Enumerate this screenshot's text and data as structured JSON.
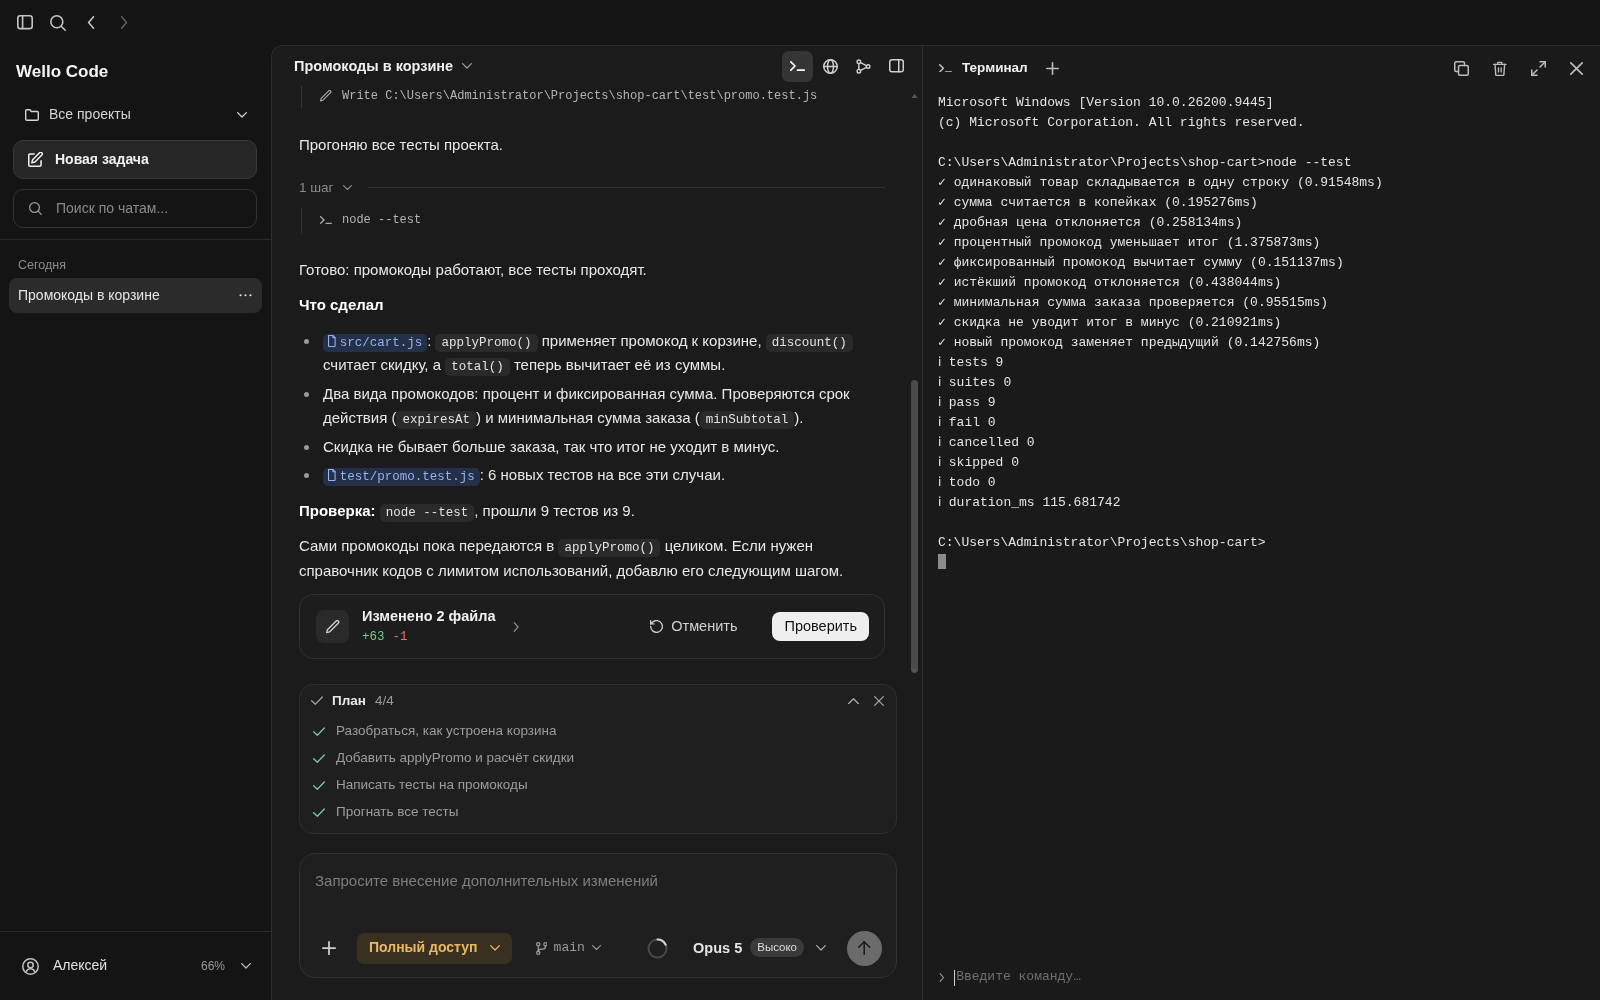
{
  "navigation": {
    "back_disabled": false,
    "forward_disabled": true
  },
  "sidebar": {
    "app_title": "Wello Code",
    "project_filter": "Все проекты",
    "new_task": "Новая задача",
    "search": {
      "placeholder": "Поиск по чатам..."
    },
    "sections": [
      {
        "heading": "Сегодня",
        "items": [
          {
            "label": "Промокоды в корзине",
            "selected": true
          }
        ]
      }
    ],
    "user": {
      "name": "Алексей",
      "usage": "66%"
    }
  },
  "chat": {
    "title": "Промокоды в корзине",
    "tools": [
      {
        "kind": "terminal",
        "selected": true
      },
      {
        "kind": "globe",
        "selected": false
      },
      {
        "kind": "nodes",
        "selected": false
      },
      {
        "kind": "panel",
        "selected": false
      }
    ],
    "blocks": [
      {
        "kind": "write_call",
        "text": "Write C:\\Users\\Administrator\\Projects\\shop-cart\\test\\promo.test.js"
      },
      {
        "kind": "paragraph",
        "parts": [
          {
            "kind": "text",
            "text": "Прогоняю все тесты проекта."
          }
        ]
      },
      {
        "kind": "steps",
        "label": "1 шаг",
        "expanded": true,
        "calls": [
          {
            "kind": "command",
            "text": "node --test"
          }
        ]
      },
      {
        "kind": "paragraph",
        "parts": [
          {
            "kind": "text",
            "text": "Готово: промокоды работают, все тесты проходят."
          }
        ]
      },
      {
        "kind": "heading",
        "text": "Что сделал"
      },
      {
        "kind": "list",
        "items": [
          {
            "parts": [
              {
                "kind": "file",
                "text": "src/cart.js"
              },
              {
                "kind": "text",
                "text": ": "
              },
              {
                "kind": "code",
                "text": "applyPromo()"
              },
              {
                "kind": "text",
                "text": " применяет промокод к корзине, "
              },
              {
                "kind": "code",
                "text": "discount()"
              },
              {
                "kind": "text",
                "text": " считает скидку, а "
              },
              {
                "kind": "code",
                "text": "total()"
              },
              {
                "kind": "text",
                "text": " теперь вычитает её из суммы."
              }
            ]
          },
          {
            "parts": [
              {
                "kind": "text",
                "text": "Два вида промокодов: процент и фиксированная сумма. Проверяются срок действия ("
              },
              {
                "kind": "code",
                "text": "expiresAt"
              },
              {
                "kind": "text",
                "text": ") и минимальная сумма заказа ("
              },
              {
                "kind": "code",
                "text": "minSubtotal"
              },
              {
                "kind": "text",
                "text": ")."
              }
            ]
          },
          {
            "parts": [
              {
                "kind": "text",
                "text": "Скидка не бывает больше заказа, так что итог не уходит в минус."
              }
            ]
          },
          {
            "parts": [
              {
                "kind": "file",
                "text": "test/promo.test.js"
              },
              {
                "kind": "text",
                "text": ": 6 новых тестов на все эти случаи."
              }
            ]
          }
        ]
      },
      {
        "kind": "paragraph",
        "parts": [
          {
            "kind": "text",
            "text": "**Проверка:** "
          },
          {
            "kind": "code",
            "text": "node --test"
          },
          {
            "kind": "text",
            "text": ", прошли 9 тестов из 9."
          }
        ]
      },
      {
        "kind": "paragraph",
        "parts": [
          {
            "kind": "text",
            "text": "Сами промокоды пока передаются в "
          },
          {
            "kind": "code",
            "text": "applyPromo()"
          },
          {
            "kind": "text",
            "text": " целиком. Если нужен справочник кодов с лимитом использований, добавлю его следующим шагом."
          }
        ]
      }
    ],
    "changes": {
      "title": "Изменено 2 файла",
      "added": "+63",
      "removed": "-1",
      "actions": [
        {
          "kind": "undo",
          "label": "Отменить"
        },
        {
          "kind": "review",
          "label": "Проверить"
        }
      ]
    },
    "plan": {
      "title": "План",
      "count": "4/4",
      "expanded": true,
      "items": [
        {
          "label": "Разобраться, как устроена корзина",
          "done": true
        },
        {
          "label": "Добавить applyPromo и расчёт скидки",
          "done": true
        },
        {
          "label": "Написать тесты на промокоды",
          "done": true
        },
        {
          "label": "Прогнать все тесты",
          "done": true
        }
      ]
    },
    "composer": {
      "placeholder": "Запросите внесение дополнительных изменений",
      "access": "Полный доступ",
      "branch": "main",
      "model": "Opus 5",
      "effort": "Высоко"
    }
  },
  "terminal": {
    "title": "Терминал",
    "output": [
      {
        "lines": [
          "Microsoft Windows [Version 10.0.26200.9445]",
          "(c) Microsoft Corporation. All rights reserved."
        ]
      },
      {
        "lines": [
          "C:\\Users\\Administrator\\Projects\\shop-cart>node --test",
          "✓ одинаковый товар складывается в одну строку (0.91548ms)",
          "✓ сумма считается в копейках (0.195276ms)",
          "✓ дробная цена отклоняется (0.258134ms)",
          "✓ процентный промокод уменьшает итог (1.375873ms)",
          "✓ фиксированный промокод вычитает сумму (0.151137ms)",
          "✓ истёкший промокод отклоняется (0.438044ms)",
          "✓ минимальная сумма заказа проверяется (0.95515ms)",
          "✓ скидка не уводит итог в минус (0.210921ms)",
          "✓ новый промокод заменяет предыдущий (0.142756ms)",
          "ℹ tests 9",
          "ℹ suites 0",
          "ℹ pass 9",
          "ℹ fail 0",
          "ℹ cancelled 0",
          "ℹ skipped 0",
          "ℹ todo 0",
          "ℹ duration_ms 115.681742"
        ]
      },
      {
        "lines": [
          "C:\\Users\\Administrator\\Projects\\shop-cart>"
        ]
      }
    ],
    "input": {
      "placeholder": "Введите команду…"
    }
  }
}
